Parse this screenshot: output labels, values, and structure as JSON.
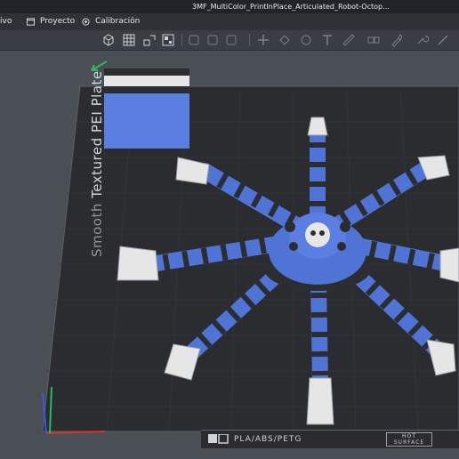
{
  "window": {
    "title": "3MF_MultiColor_PrintInPlace_Articulated_Robot-Octop..."
  },
  "menu": {
    "items": [
      {
        "label": "ivo",
        "icon": "none"
      },
      {
        "label": "Proyecto",
        "icon": "project-icon"
      },
      {
        "label": "Calibración",
        "icon": "calibration-icon"
      }
    ]
  },
  "toolbar": {
    "buttons": [
      "add-cube-icon",
      "grid-icon",
      "auto-orient-icon",
      "arrange-icon",
      "move-icon",
      "rotate-icon",
      "scale-icon",
      "cut-icon",
      "support-icon",
      "seam-icon",
      "text-icon",
      "measure-icon",
      "assembly-icon",
      "paint-icon"
    ]
  },
  "bed": {
    "label": "Textured PEI Plate",
    "label_prefix": "Smooth",
    "plate_text": "PLA/ABS/PETG",
    "surface_text_line1": "HOT",
    "surface_text_line2": "SURFACE"
  },
  "colors": {
    "accent_blue": "#4f74d6",
    "dark_gray": "#2b2d31",
    "white_part": "#e6e6e6",
    "bed": "#2a2c30",
    "background": "#4a4e55"
  }
}
